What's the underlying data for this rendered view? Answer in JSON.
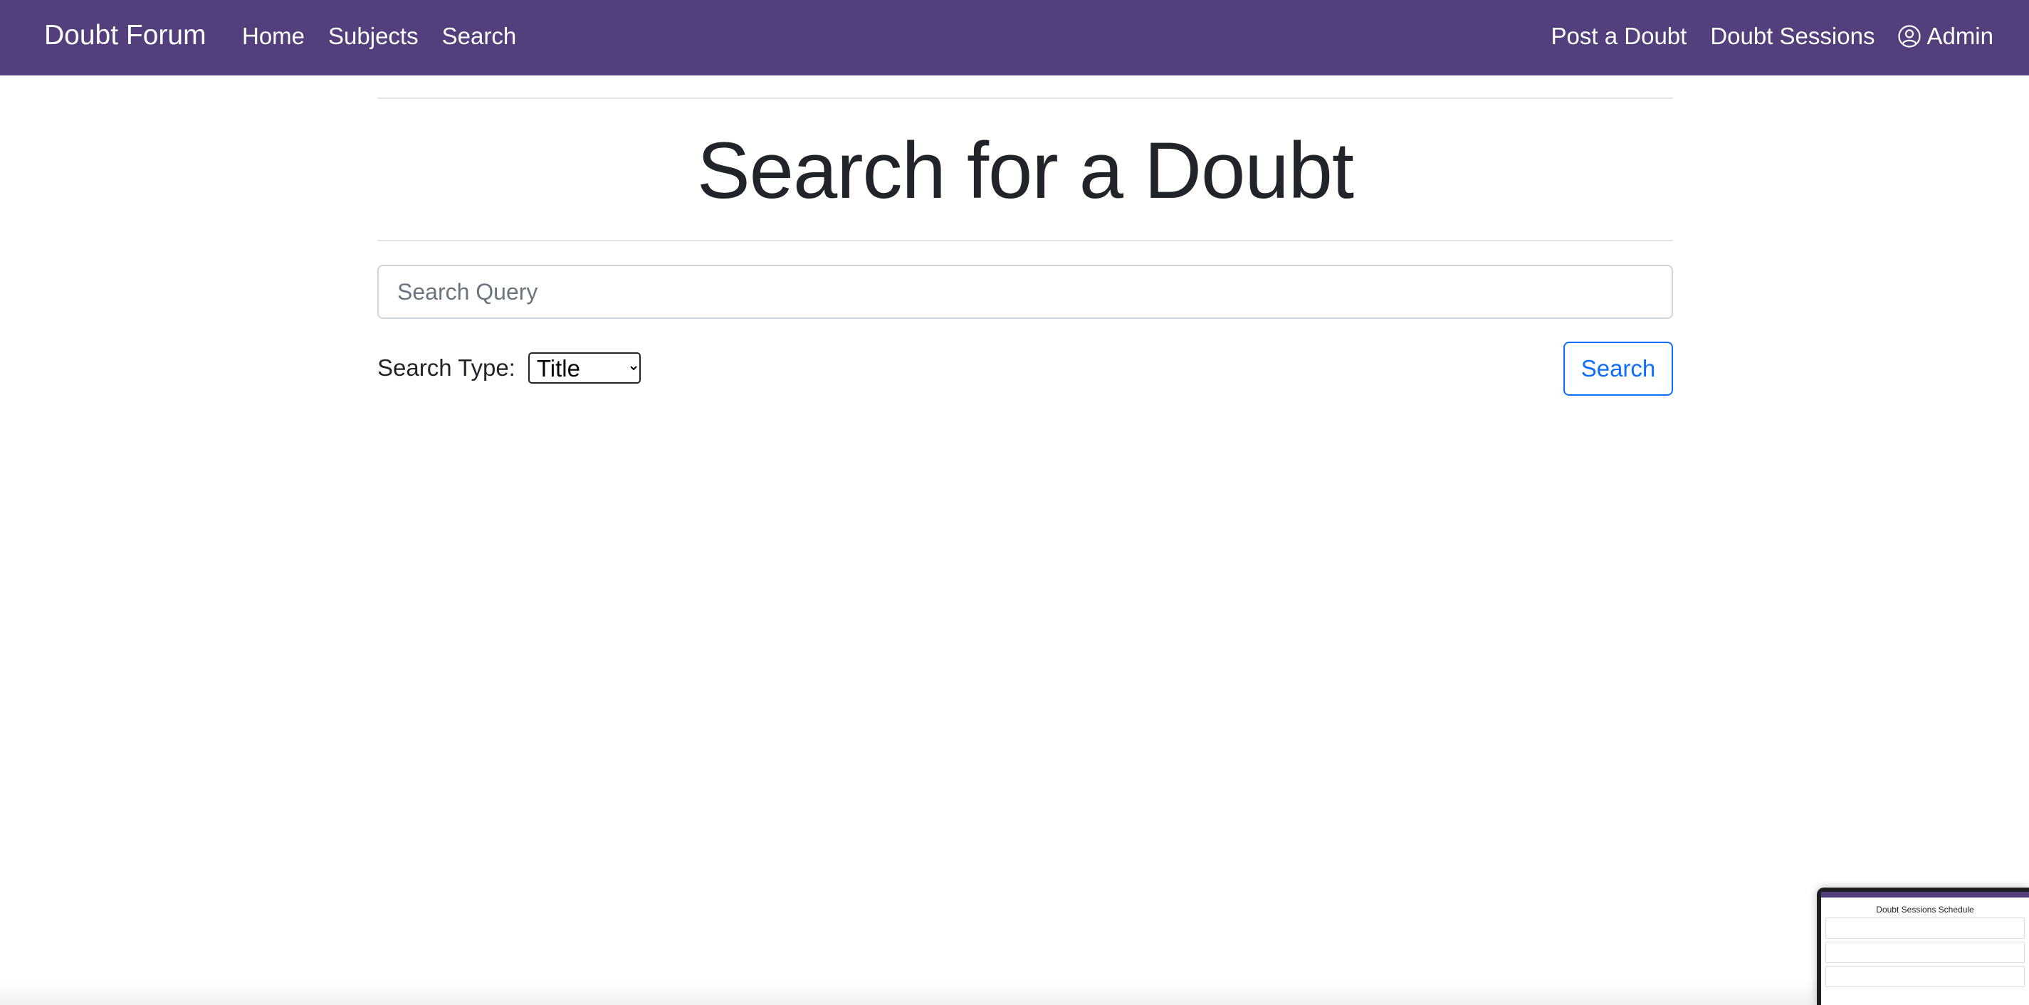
{
  "navbar": {
    "brand": "Doubt Forum",
    "left_links": [
      "Home",
      "Subjects",
      "Search"
    ],
    "right_links": [
      "Post a Doubt",
      "Doubt Sessions"
    ],
    "user_label": "Admin",
    "background": "#533f7b"
  },
  "main": {
    "title": "Search for a Doubt",
    "search_placeholder": "Search Query",
    "search_value": "",
    "type_label": "Search Type:",
    "type_selected": "Title",
    "search_button": "Search",
    "accent": "#0d6efd"
  },
  "thumbnail": {
    "title": "Doubt Sessions Schedule"
  },
  "icons": {
    "user": "user-circle-icon"
  }
}
